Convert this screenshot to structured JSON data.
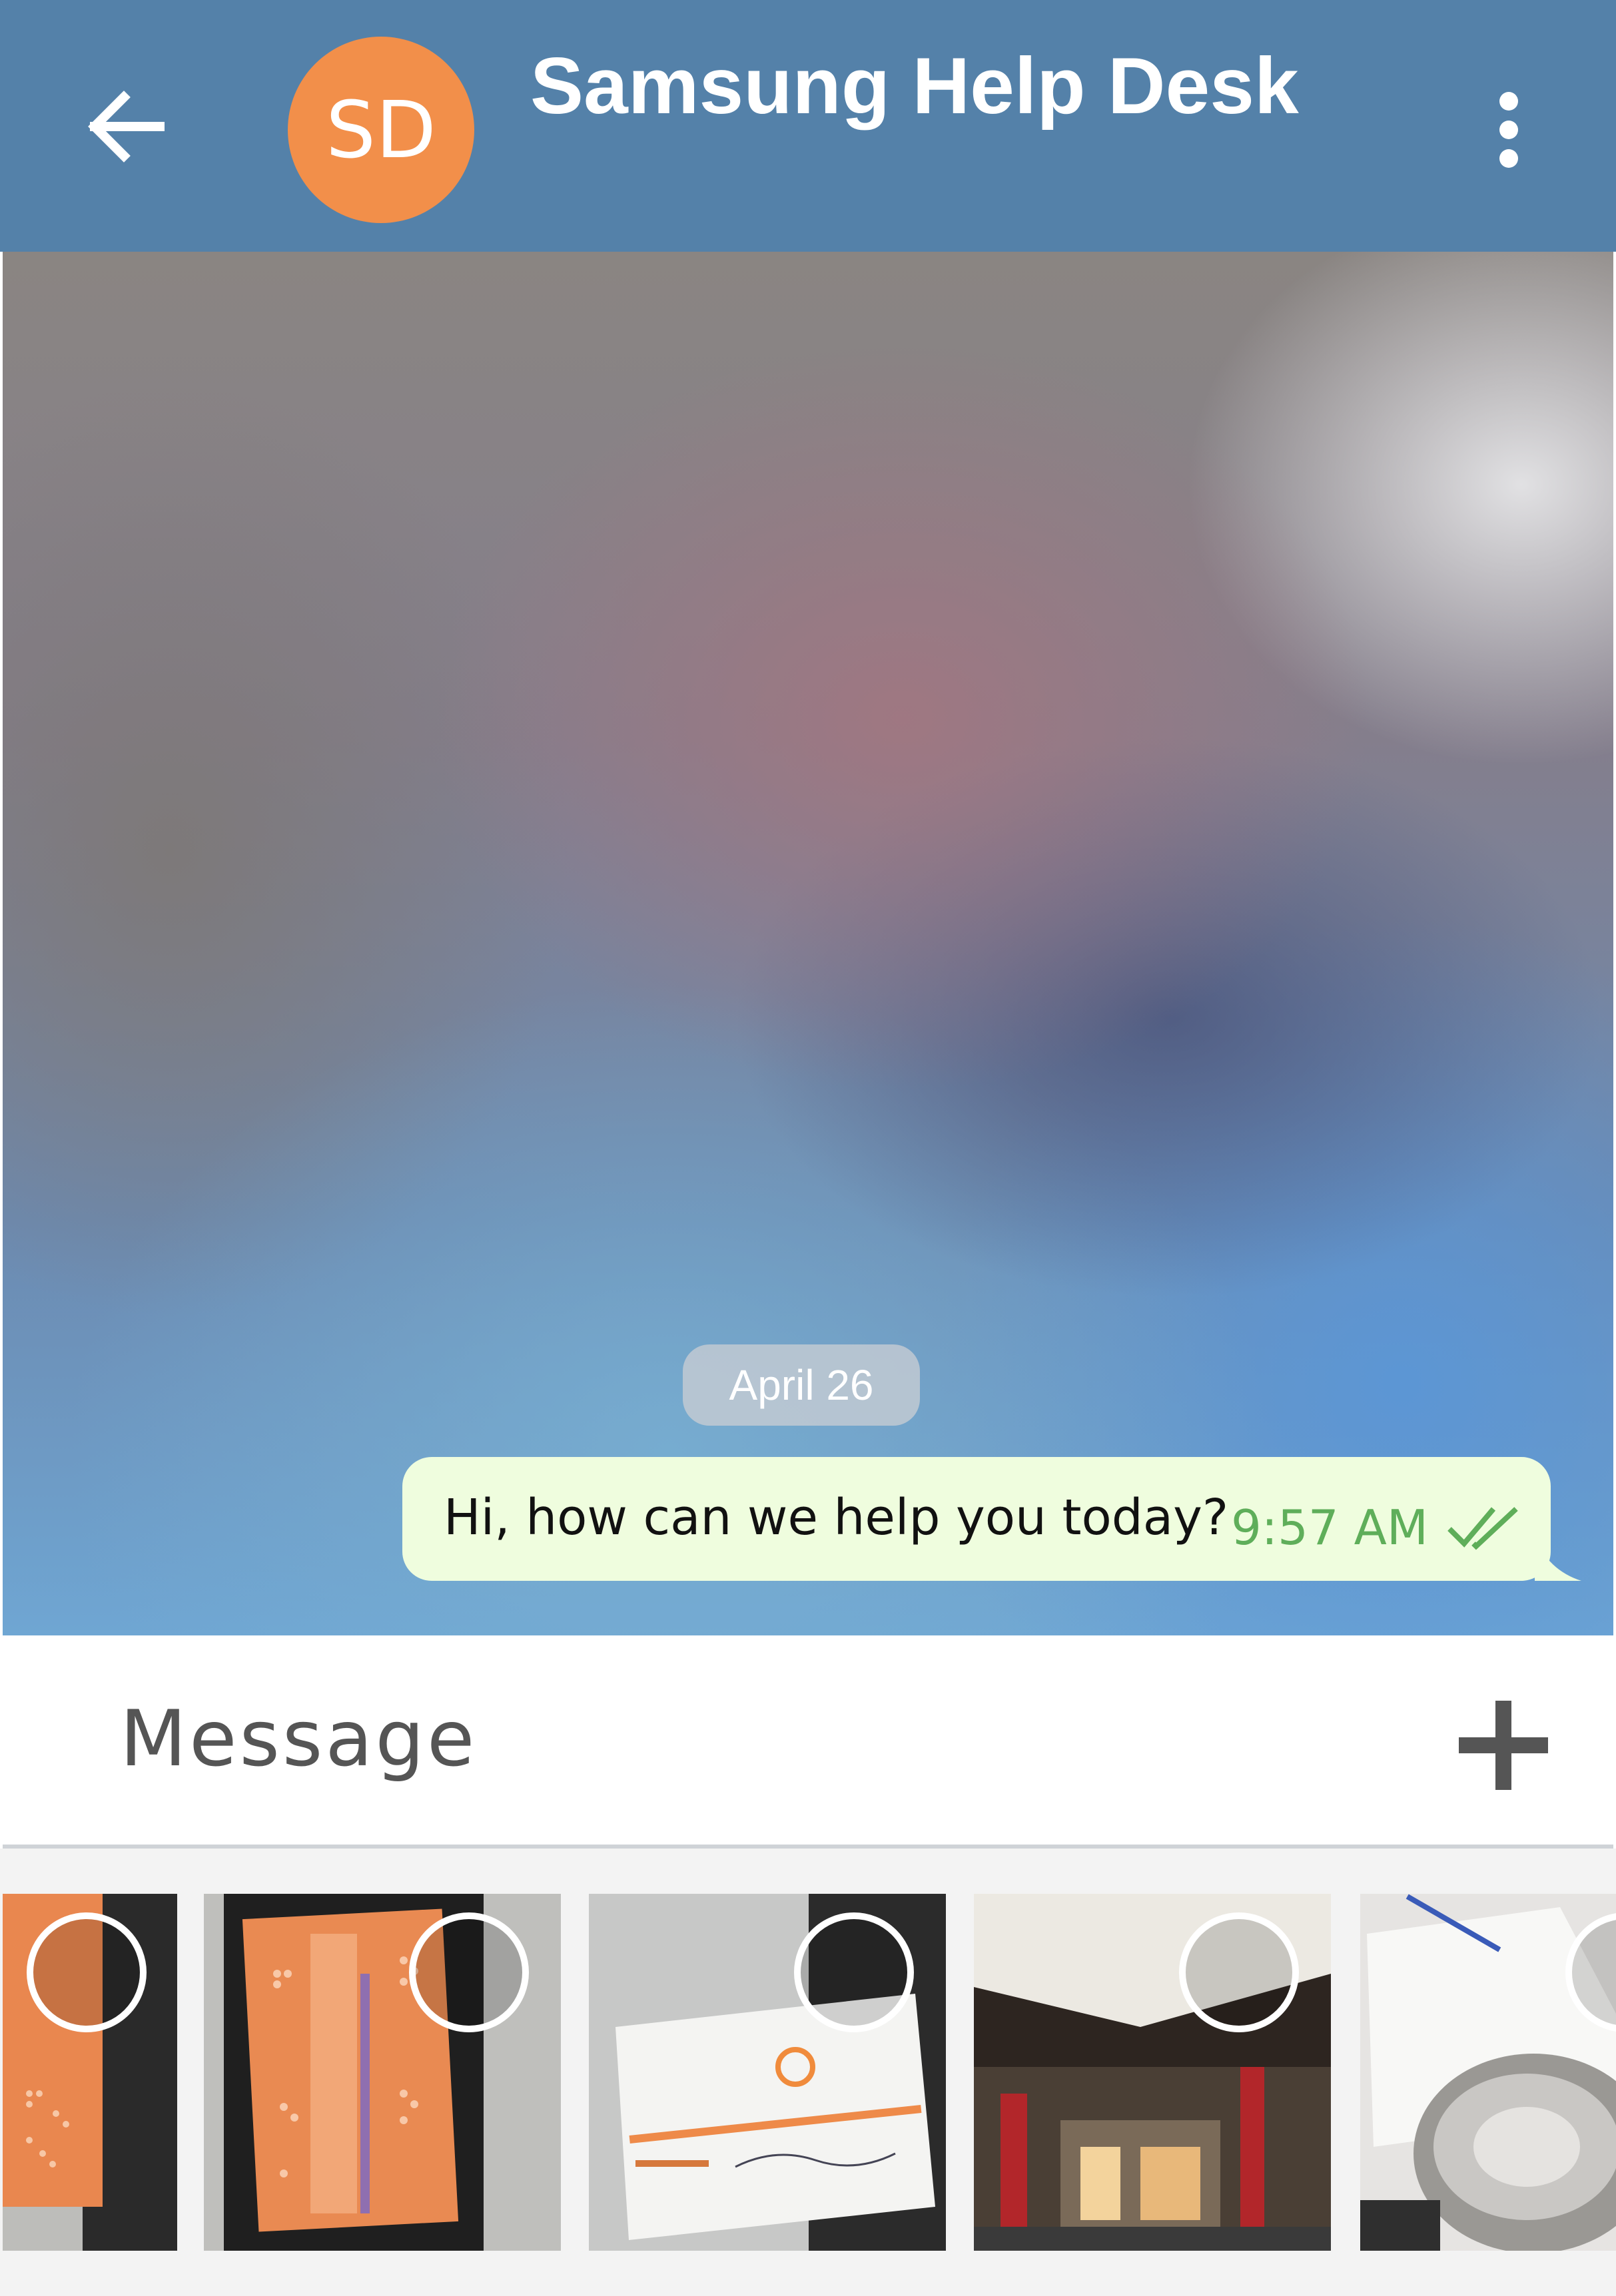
{
  "header": {
    "avatar_initials": "SD",
    "title": "Samsung Help Desk",
    "back_icon": "arrow-left-icon",
    "menu_icon": "more-vertical-icon",
    "colors": {
      "bar": "#5481a9",
      "avatar": "#f28f4a"
    }
  },
  "chat": {
    "date_separator": "April 26",
    "messages": [
      {
        "text": "Hi, how can we help you today?",
        "time": "9:57 AM",
        "status_icon": "double-check-icon"
      }
    ],
    "colors": {
      "outgoing_bubble": "#effdde",
      "time": "#5fae5a"
    }
  },
  "composer": {
    "placeholder": "Message",
    "attach_icon": "plus-icon"
  },
  "gallery": {
    "photos": [
      {
        "subject": "orange card"
      },
      {
        "subject": "orange card"
      },
      {
        "subject": "business card"
      },
      {
        "subject": "building"
      },
      {
        "subject": "papers"
      }
    ]
  }
}
